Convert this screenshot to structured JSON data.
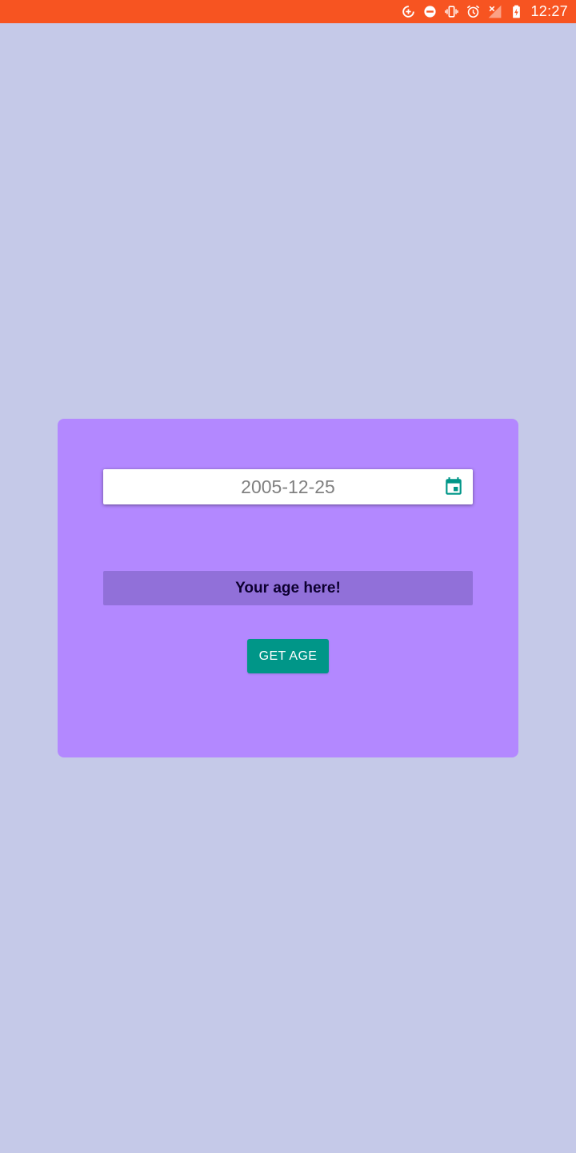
{
  "status_bar": {
    "time": "12:27",
    "background_color": "#f75421",
    "icons": [
      "data-saver-icon",
      "do-not-disturb-icon",
      "vibrate-icon",
      "alarm-icon",
      "no-signal-icon",
      "battery-charging-icon"
    ]
  },
  "card": {
    "background_color": "#b388ff",
    "date_input": {
      "value": "2005-12-25",
      "icon": "calendar-icon",
      "icon_color": "#009688"
    },
    "age_output": {
      "text": "Your age here!",
      "background_color": "#9170d9"
    },
    "get_age_button": {
      "label": "GET AGE",
      "background_color": "#009688"
    }
  },
  "page_background_color": "#c5c9e8"
}
